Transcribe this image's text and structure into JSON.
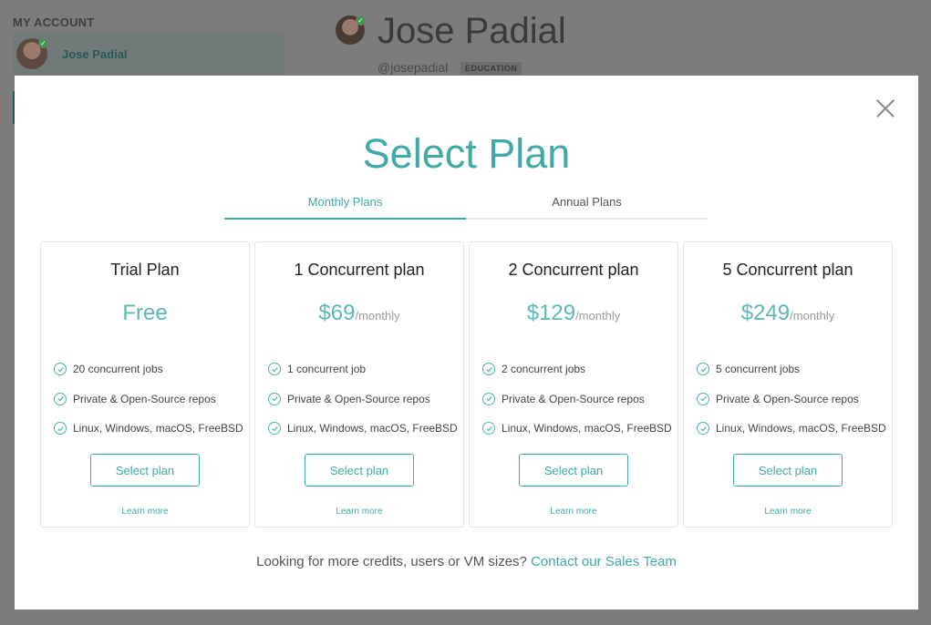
{
  "background": {
    "section_title": "MY ACCOUNT",
    "account_name": "Jose Padial",
    "profile_name": "Jose Padial",
    "profile_handle": "@josepadial",
    "profile_tag": "EDUCATION"
  },
  "modal": {
    "title": "Select Plan",
    "tabs": [
      {
        "label": "Monthly Plans",
        "active": true
      },
      {
        "label": "Annual Plans",
        "active": false
      }
    ],
    "plans": [
      {
        "name": "Trial Plan",
        "price": "Free",
        "period": "",
        "features": [
          "20 concurrent jobs",
          "Private & Open-Source repos",
          "Linux, Windows, macOS, FreeBSD"
        ],
        "button_label": "Select plan",
        "learn_more": "Learn more"
      },
      {
        "name": "1 Concurrent plan",
        "price": "$69",
        "period": "/monthly",
        "features": [
          "1 concurrent job",
          "Private & Open-Source repos",
          "Linux, Windows, macOS, FreeBSD"
        ],
        "button_label": "Select plan",
        "learn_more": "Learn more"
      },
      {
        "name": "2 Concurrent plan",
        "price": "$129",
        "period": "/monthly",
        "features": [
          "2 concurrent jobs",
          "Private & Open-Source repos",
          "Linux, Windows, macOS, FreeBSD"
        ],
        "button_label": "Select plan",
        "learn_more": "Learn more"
      },
      {
        "name": "5 Concurrent plan",
        "price": "$249",
        "period": "/monthly",
        "features": [
          "5 concurrent jobs",
          "Private & Open-Source repos",
          "Linux, Windows, macOS, FreeBSD"
        ],
        "button_label": "Select plan",
        "learn_more": "Learn more"
      }
    ],
    "footer_text": "Looking for more credits, users or VM sizes?",
    "footer_link": "Contact our Sales Team"
  },
  "icons": {
    "close": "close-icon",
    "check": "check-circle-icon"
  },
  "colors": {
    "accent": "#3faaa6",
    "overlay": "#7c7c7c"
  }
}
